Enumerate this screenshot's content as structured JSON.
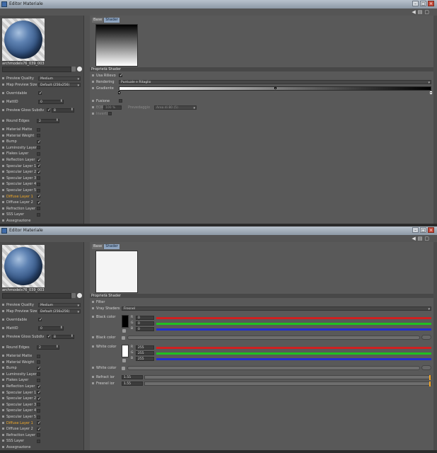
{
  "window_title": "Editor Materiale",
  "material": {
    "name": "archmodels76_039_003",
    "name_field": ""
  },
  "left_props": {
    "preview_quality": {
      "label": "Preview Quality",
      "value": "Medium"
    },
    "map_preview_size": {
      "label": "Map Preview Size",
      "value": "Default (256x256)"
    },
    "overridable": {
      "label": "Overridable",
      "checked": true
    },
    "mattid": {
      "label": "MattID",
      "value": "0"
    },
    "preview_gloss": {
      "label": "Preview Gloss Subdiv",
      "checked": true,
      "value": "8"
    },
    "round_edges": {
      "label": "Round Edges",
      "value": "2"
    }
  },
  "layers": [
    {
      "label": "Material Matte",
      "checked": false,
      "active": false
    },
    {
      "label": "Material Weight",
      "checked": false,
      "active": false
    },
    {
      "label": "Bump",
      "checked": true,
      "active": false
    },
    {
      "label": "Luminosity Layer",
      "checked": false,
      "active": false
    },
    {
      "label": "Flakes Layer",
      "checked": false,
      "active": false
    },
    {
      "label": "Reflection Layer",
      "checked": true,
      "active": false
    },
    {
      "label": "Specular Layer 1",
      "checked": true,
      "active": false
    },
    {
      "label": "Specular Layer 2",
      "checked": true,
      "active": false
    },
    {
      "label": "Specular Layer 3",
      "checked": false,
      "active": false
    },
    {
      "label": "Specular Layer 4",
      "checked": false,
      "active": false
    },
    {
      "label": "Specular Layer 5",
      "checked": false,
      "active": false
    },
    {
      "label": "Diffuse Layer 1",
      "checked": true,
      "active": true
    },
    {
      "label": "Diffuse Layer 2",
      "checked": true,
      "active": false
    },
    {
      "label": "Refraction Layer",
      "checked": false,
      "active": false
    },
    {
      "label": "SSS Layer",
      "checked": false,
      "active": false
    },
    {
      "label": "Assegnazione",
      "checked": false,
      "active": false
    }
  ],
  "tabs": [
    "Base",
    "Shader"
  ],
  "top_shader": {
    "section": "Proprietà Shader",
    "use_bump": "Usa Rilievo",
    "rendering_label": "Rendering",
    "rendering_value": "Puntuale e Ritaglio",
    "gradient_label": "Gradiente",
    "fusion": "Fusione",
    "eor_label": "EOR",
    "eor_value": "100 %",
    "preview_label": "Prevedaggio",
    "preview_value": "Area di 80 (5)",
    "invert": "Inverti"
  },
  "bottom_shader": {
    "section": "Proprietà Shader",
    "filter_label": "Filter",
    "vray_shaders_label": "Vray Shaders",
    "vray_shaders_value": "Fresnel",
    "black_color_label": "Black color",
    "black_rgb": {
      "R": "0",
      "G": "0",
      "B": "0"
    },
    "black_color_tex": "Black color",
    "white_color_label": "White color",
    "white_rgb": {
      "R": "255",
      "G": "255",
      "B": "255"
    },
    "white_color_tex": "White color",
    "refract_ior_label": "Refract ior",
    "refract_ior_value": "1.55",
    "fresnel_ior_label": "Fresnel ior",
    "fresnel_ior_value": "1.55"
  },
  "colors": {
    "accent_tab": "#8fa5c0",
    "active_layer": "#f0a92a",
    "red_channel": "#d02020",
    "green_channel": "#20c020",
    "blue_channel": "#2030d0"
  }
}
